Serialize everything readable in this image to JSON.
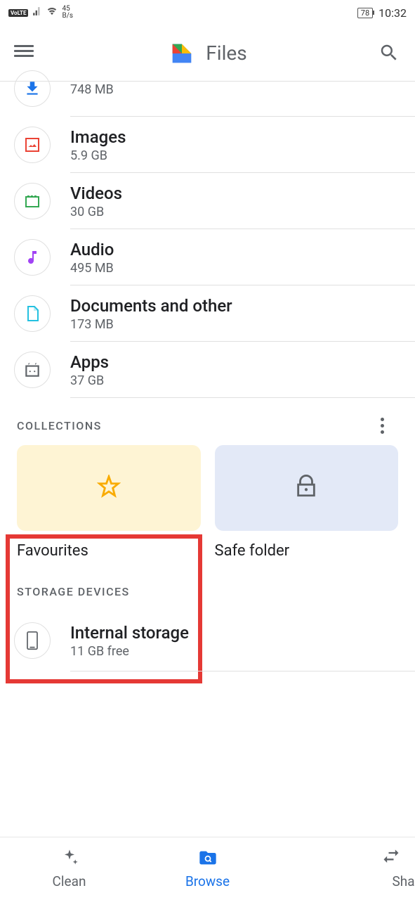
{
  "status_bar": {
    "net_rate": "45",
    "net_unit": "B/s",
    "battery": "78",
    "time": "10:32"
  },
  "app": {
    "name": "Files"
  },
  "categories": [
    {
      "name": "",
      "size": "748 MB",
      "icon": "download",
      "color": "#1a73e8"
    },
    {
      "name": "Images",
      "size": "5.9 GB",
      "icon": "image",
      "color": "#ea4335"
    },
    {
      "name": "Videos",
      "size": "30 GB",
      "icon": "video",
      "color": "#34a853"
    },
    {
      "name": "Audio",
      "size": "495 MB",
      "icon": "audio",
      "color": "#a142f4"
    },
    {
      "name": "Documents and other",
      "size": "173 MB",
      "icon": "document",
      "color": "#24c1e0"
    },
    {
      "name": "Apps",
      "size": "37 GB",
      "icon": "apps",
      "color": "#5f6368"
    }
  ],
  "collections": {
    "title": "COLLECTIONS",
    "items": [
      {
        "label": "Favourites",
        "type": "fav"
      },
      {
        "label": "Safe folder",
        "type": "safe"
      }
    ]
  },
  "storage_devices": {
    "title": "STORAGE DEVICES",
    "items": [
      {
        "name": "Internal storage",
        "free": "11 GB free"
      }
    ]
  },
  "bottom_nav": {
    "items": [
      {
        "label": "Clean",
        "icon": "sparkle",
        "active": false
      },
      {
        "label": "Browse",
        "icon": "folder-search",
        "active": true
      },
      {
        "label": "Share",
        "icon": "swap",
        "active": false
      }
    ]
  }
}
